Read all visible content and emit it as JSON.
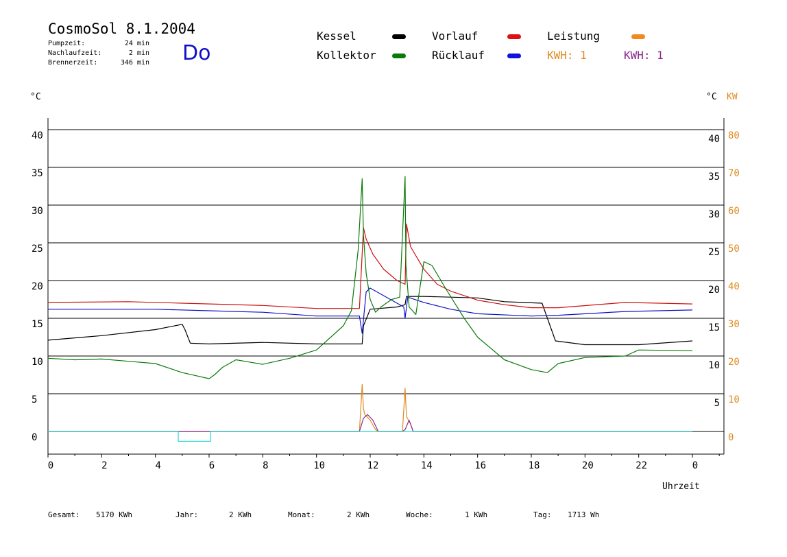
{
  "header": {
    "title": "CosmoSol 8.1.2004",
    "day": "Do",
    "pump_label": "Pumpzeit:",
    "pump_value": "24 min",
    "nachlauf_label": "Nachlaufzeit:",
    "nachlauf_value": "2 min",
    "brenner_label": "Brennerzeit:",
    "brenner_value": "346 min"
  },
  "legend": {
    "kessel": "Kessel",
    "kollektor": "Kollektor",
    "vorlauf": "Vorlauf",
    "ruecklauf": "Rücklauf",
    "leistung": "Leistung",
    "kwh1": "KWH: 1",
    "kwh2": "KWH: 1"
  },
  "colors": {
    "kessel": "#000000",
    "kollektor": "#0a7a0a",
    "vorlauf": "#cc1010",
    "ruecklauf": "#1010c8",
    "leistung": "#e08a1e",
    "kwh2": "#8a2a8a",
    "pumpe": "#22d4d4"
  },
  "axes": {
    "left_unit": "°C",
    "right_unit": "°C",
    "right_unit2": "KW",
    "xlabel": "Uhrzeit"
  },
  "footer": {
    "gesamt_label": "Gesamt:",
    "gesamt_value": "5170 KWh",
    "jahr_label": "Jahr:",
    "jahr_value": "2 KWh",
    "monat_label": "Monat:",
    "monat_value": "2 KWh",
    "woche_label": "Woche:",
    "woche_value": "1 KWh",
    "tag_label": "Tag:",
    "tag_value": "1713 Wh"
  },
  "chart_data": {
    "type": "line",
    "title": "CosmoSol 8.1.2004",
    "xlabel": "Uhrzeit",
    "x_ticks": [
      0,
      2,
      4,
      6,
      8,
      10,
      12,
      14,
      16,
      18,
      20,
      22,
      24
    ],
    "x_tick_labels": [
      "0",
      "2",
      "4",
      "6",
      "8",
      "10",
      "12",
      "14",
      "16",
      "18",
      "20",
      "22",
      "0"
    ],
    "xlim": [
      0,
      24
    ],
    "ylim": [
      0,
      40
    ],
    "y_ticks_left": [
      0,
      5,
      10,
      15,
      20,
      25,
      30,
      35,
      40
    ],
    "y_ticks_right": [
      5,
      10,
      15,
      20,
      25,
      30,
      35,
      40
    ],
    "y2_ticks": [
      0,
      10,
      20,
      30,
      40,
      50,
      60,
      70,
      80
    ],
    "y2lim": [
      0,
      80
    ],
    "grid": true,
    "series": [
      {
        "name": "Kessel",
        "key": "kessel",
        "x": [
          0,
          2,
          4,
          5.0,
          5.1,
          5.3,
          6,
          8,
          10,
          11.7,
          11.75,
          12,
          13,
          13.3,
          13.35,
          14,
          16,
          17,
          18.4,
          18.6,
          18.9,
          20,
          22,
          24
        ],
        "y": [
          12.1,
          12.7,
          13.5,
          14.2,
          13.5,
          11.7,
          11.6,
          11.8,
          11.6,
          11.6,
          14.0,
          16.2,
          16.5,
          16.8,
          17.9,
          17.9,
          17.7,
          17.2,
          17.0,
          15.0,
          12.0,
          11.5,
          11.5,
          12.0
        ]
      },
      {
        "name": "Vorlauf",
        "key": "vorlauf",
        "x": [
          0,
          3,
          5,
          8,
          10,
          11.6,
          11.75,
          11.85,
          12.1,
          12.5,
          13.0,
          13.3,
          13.35,
          13.5,
          14.0,
          14.5,
          15,
          16,
          17,
          18,
          19,
          21.5,
          24
        ],
        "y": [
          17.1,
          17.2,
          17.0,
          16.7,
          16.3,
          16.3,
          27.0,
          25.5,
          23.5,
          21.5,
          20.0,
          19.5,
          27.5,
          24.5,
          21.5,
          19.5,
          18.6,
          17.4,
          16.8,
          16.4,
          16.4,
          17.1,
          16.9
        ]
      },
      {
        "name": "Rücklauf",
        "key": "ruecklauf",
        "x": [
          0,
          4,
          6,
          8,
          10,
          11.6,
          11.7,
          11.85,
          12.0,
          12.5,
          13.0,
          13.25,
          13.3,
          13.4,
          14,
          15,
          16,
          18,
          19,
          21.5,
          24
        ],
        "y": [
          16.2,
          16.2,
          16.0,
          15.8,
          15.3,
          15.3,
          13.0,
          18.5,
          19.0,
          18.0,
          17.0,
          16.5,
          15.0,
          17.8,
          17.1,
          16.2,
          15.6,
          15.3,
          15.4,
          15.9,
          16.1
        ]
      },
      {
        "name": "Kollektor",
        "key": "kollektor",
        "x": [
          0,
          1,
          2,
          3,
          4,
          5,
          5.5,
          6,
          6.2,
          6.5,
          7,
          7.5,
          8,
          9,
          10,
          11,
          11.3,
          11.55,
          11.7,
          11.75,
          11.85,
          12.0,
          12.2,
          12.4,
          12.8,
          13.1,
          13.3,
          13.33,
          13.45,
          13.7,
          14.0,
          14.3,
          14.8,
          15.5,
          16,
          17,
          18,
          18.6,
          19,
          20,
          21.5,
          22,
          24
        ],
        "y": [
          9.7,
          9.5,
          9.6,
          9.3,
          9.0,
          7.8,
          7.4,
          7.0,
          7.5,
          8.5,
          9.5,
          9.2,
          8.9,
          9.7,
          10.8,
          14.0,
          16.0,
          24.0,
          33.5,
          26.0,
          21.0,
          17.5,
          15.8,
          16.5,
          17.5,
          17.8,
          33.8,
          22.0,
          16.5,
          15.5,
          22.5,
          22.0,
          19.0,
          15.0,
          12.5,
          9.5,
          8.2,
          7.8,
          9.0,
          9.8,
          10.0,
          10.8,
          10.7
        ]
      },
      {
        "name": "Leistung",
        "key": "leistung",
        "axis": "right",
        "x": [
          0,
          11.6,
          11.7,
          11.75,
          11.8,
          12.0,
          12.2,
          12.3,
          13.2,
          13.3,
          13.35,
          13.5,
          13.6,
          24
        ],
        "y": [
          0,
          0,
          12.5,
          6.0,
          4.5,
          3.0,
          0.5,
          0,
          0,
          11.5,
          4.0,
          2.0,
          0,
          0
        ]
      },
      {
        "name": "KWH: 1",
        "key": "kwh2",
        "axis": "right",
        "x": [
          0,
          11.6,
          11.75,
          11.9,
          12.1,
          12.3,
          13.2,
          13.3,
          13.45,
          13.6,
          24
        ],
        "y": [
          0,
          0,
          3.5,
          4.5,
          3.0,
          0,
          0,
          0.5,
          3.0,
          0,
          0
        ]
      },
      {
        "name": "Pumpe",
        "key": "pumpe",
        "x": [
          0,
          4.85,
          4.85,
          6.05,
          6.05,
          24
        ],
        "y": [
          0,
          0,
          -1.3,
          -1.3,
          0,
          0
        ]
      }
    ]
  }
}
